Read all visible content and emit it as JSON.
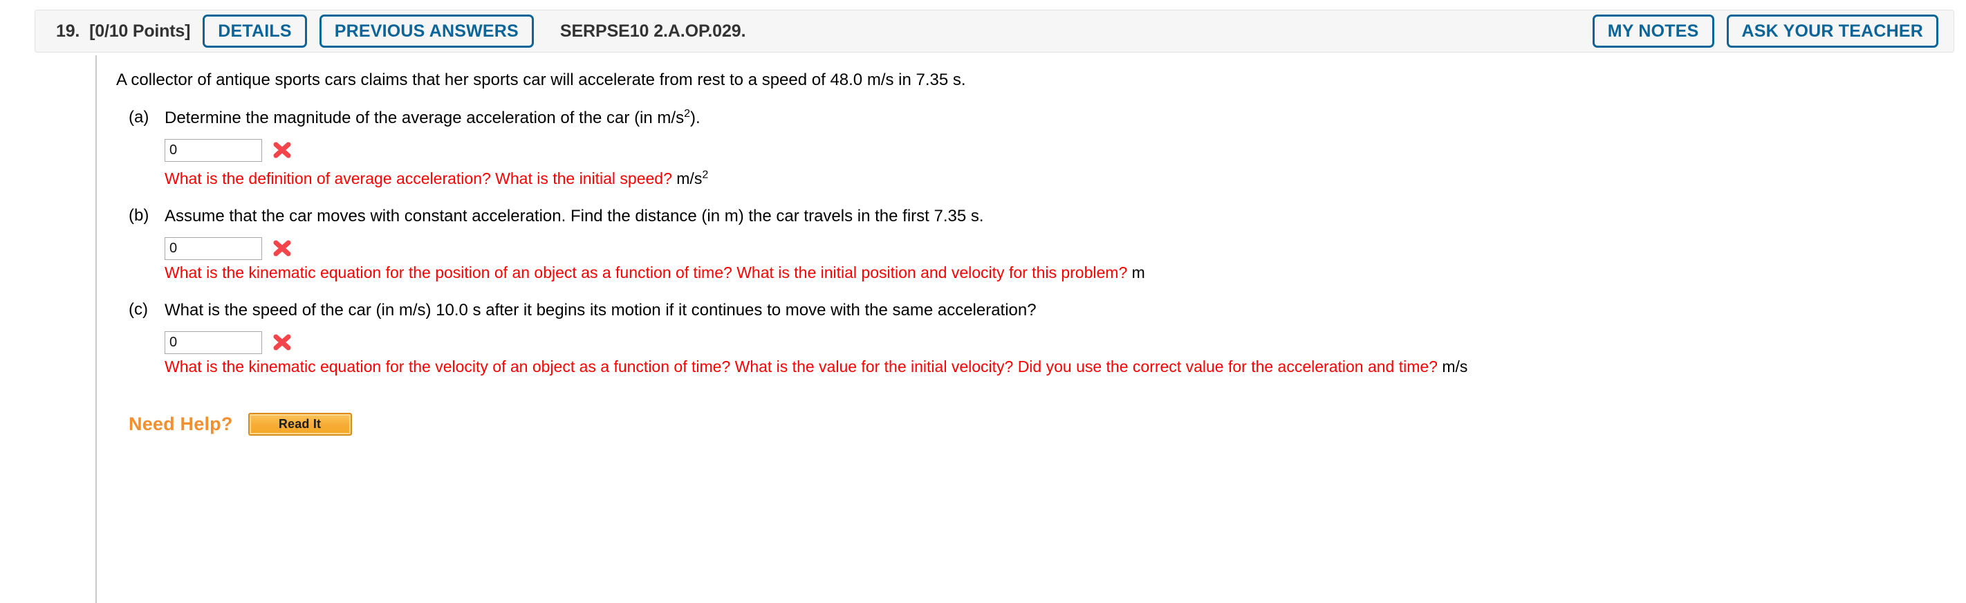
{
  "header": {
    "question_number": "19.",
    "points": "[0/10 Points]",
    "details_label": "DETAILS",
    "previous_answers_label": "PREVIOUS ANSWERS",
    "question_code": "SERPSE10 2.A.OP.029.",
    "my_notes_label": "MY NOTES",
    "ask_your_teacher_label": "ASK YOUR TEACHER",
    "accent_color": "#0b6599",
    "background_color": "#f6f6f6"
  },
  "question": {
    "stem": "A collector of antique sports cars claims that her sports car will accelerate from rest to a speed of 48.0 m/s in 7.35 s.",
    "parts": [
      {
        "label": "(a)",
        "prompt_before": "Determine the magnitude of the average acceleration of the car (in m/s",
        "prompt_sup": "2",
        "prompt_after": ").",
        "answer_value": "0",
        "mark": "incorrect-x",
        "feedback": "What is the definition of average acceleration? What is the initial speed?",
        "unit_before": "m/s",
        "unit_sup": "2",
        "feedback_spacing": "normal"
      },
      {
        "label": "(b)",
        "prompt_before": "Assume that the car moves with constant acceleration. Find the distance (in m) the car travels in the first 7.35 s.",
        "prompt_sup": "",
        "prompt_after": "",
        "answer_value": "0",
        "mark": "incorrect-x",
        "feedback": "What is the kinematic equation for the position of an object as a function of time? What is the initial position and velocity for this problem?",
        "unit_before": "m",
        "unit_sup": "",
        "feedback_spacing": "tight"
      },
      {
        "label": "(c)",
        "prompt_before": "What is the speed of the car (in m/s) 10.0 s after it begins its motion if it continues to move with the same acceleration?",
        "prompt_sup": "",
        "prompt_after": "",
        "answer_value": "0",
        "mark": "incorrect-x",
        "feedback": "What is the kinematic equation for the velocity of an object as a function of time? What is the value for the initial velocity? Did you use the correct value for the acceleration and time?",
        "unit_before": "m/s",
        "unit_sup": "",
        "feedback_spacing": "tight"
      }
    ]
  },
  "need_help": {
    "label": "Need Help?",
    "read_it_label": "Read It",
    "label_color": "#f28f2e",
    "button_color": "#f5a828"
  },
  "colors": {
    "feedback_red": "#ff0000",
    "mark_red": "#f4454a"
  }
}
